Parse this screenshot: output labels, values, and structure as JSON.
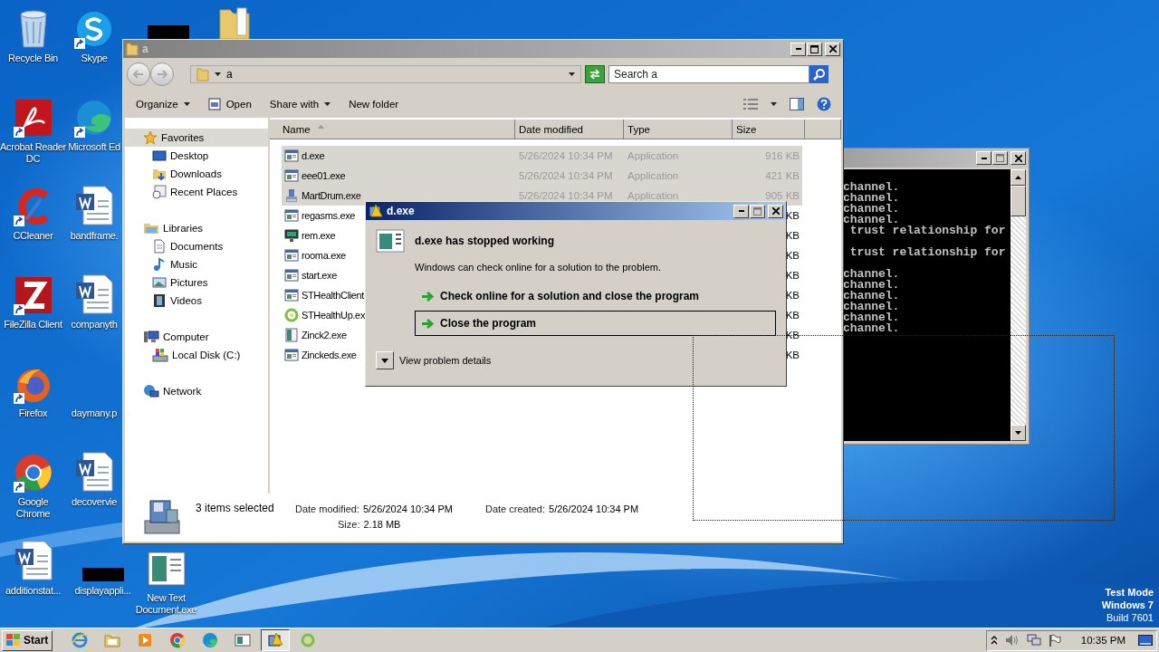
{
  "desktop": {
    "icons": [
      {
        "label": "Recycle Bin",
        "kind": "recycle",
        "shortcut": false
      },
      {
        "label": "Acrobat Reader DC",
        "kind": "acrobat",
        "shortcut": true
      },
      {
        "label": "CCleaner",
        "kind": "ccleaner",
        "shortcut": true
      },
      {
        "label": "FileZilla Client",
        "kind": "filezilla",
        "shortcut": true
      },
      {
        "label": "Firefox",
        "kind": "firefox",
        "shortcut": true
      },
      {
        "label": "Google Chrome",
        "kind": "chrome",
        "shortcut": true
      },
      {
        "label": "additionstat...",
        "kind": "word",
        "shortcut": false
      },
      {
        "label": "Skype",
        "kind": "skype",
        "shortcut": true
      },
      {
        "label": "Microsoft Ed",
        "kind": "edge",
        "shortcut": true
      },
      {
        "label": "bandframe.",
        "kind": "word",
        "shortcut": false
      },
      {
        "label": "companyth",
        "kind": "word",
        "shortcut": false
      },
      {
        "label": "daymany.p",
        "kind": "blank",
        "shortcut": false
      },
      {
        "label": "decovervie",
        "kind": "word",
        "shortcut": false
      },
      {
        "label": "displayappli...",
        "kind": "redacted",
        "shortcut": false
      },
      {
        "kind": "redacted",
        "shortcut": false
      },
      {
        "label": "New Text Document.exe",
        "kind": "appdoc",
        "shortcut": false
      },
      {
        "kind": "folder",
        "shortcut": false
      }
    ],
    "notice": [
      "Test Mode",
      "Windows 7",
      "Build 7601"
    ],
    "marquee": true
  },
  "console": {
    "lines": [
      {
        "text": "channel.",
        "blank_after": false
      },
      {
        "text": "channel.",
        "blank_after": false
      },
      {
        "text": "channel.",
        "blank_after": false
      },
      {
        "text": "channel.",
        "blank_after": false
      },
      {
        "text": " trust relationship for",
        "blank_after": true
      },
      {
        "text": " trust relationship for",
        "blank_after": true
      },
      {
        "text": "channel.",
        "blank_after": false
      },
      {
        "text": "channel.",
        "blank_after": false
      },
      {
        "text": "channel.",
        "blank_after": false
      },
      {
        "text": "channel.",
        "blank_after": false
      },
      {
        "text": "channel.",
        "blank_after": false
      },
      {
        "text": "channel.",
        "blank_after": false
      }
    ]
  },
  "explorer": {
    "title": "a",
    "address": "a",
    "search": {
      "placeholder": "Search a"
    },
    "toolbar": [
      {
        "label": "Organize",
        "kind": "menu"
      },
      {
        "label": "Open",
        "kind": "open"
      },
      {
        "label": "Share with",
        "kind": "menu"
      },
      {
        "label": "New folder",
        "kind": "plain"
      }
    ],
    "nav": [
      {
        "label": "Favorites",
        "kind": "star",
        "selected": true,
        "children": [
          {
            "label": "Desktop",
            "kind": "desktop",
            "selected": false
          },
          {
            "label": "Downloads",
            "kind": "downloads",
            "selected": false
          },
          {
            "label": "Recent Places",
            "kind": "recent",
            "selected": false
          }
        ]
      },
      {
        "label": "Libraries",
        "kind": "library",
        "selected": false,
        "children": [
          {
            "label": "Documents",
            "kind": "documents",
            "selected": false
          },
          {
            "label": "Music",
            "kind": "music",
            "selected": false
          },
          {
            "label": "Pictures",
            "kind": "pictures",
            "selected": false
          },
          {
            "label": "Videos",
            "kind": "videos",
            "selected": false
          }
        ]
      },
      {
        "label": "Computer",
        "kind": "computer",
        "selected": false,
        "children": [
          {
            "label": "Local Disk (C:)",
            "kind": "disk",
            "selected": false
          }
        ]
      },
      {
        "label": "Network",
        "kind": "network",
        "selected": false
      }
    ],
    "columns": [
      "Name",
      "Date modified",
      "Type",
      "Size"
    ],
    "files": [
      {
        "name": "d.exe",
        "kind": "app",
        "selected": true,
        "date": "5/26/2024 10:34 PM",
        "type": "Application",
        "size": "916 KB"
      },
      {
        "name": "eee01.exe",
        "kind": "app",
        "selected": true,
        "date": "5/26/2024 10:34 PM",
        "type": "Application",
        "size": "421 KB"
      },
      {
        "name": "MartDrum.exe",
        "kind": "installer",
        "selected": true,
        "date": "5/26/2024 10:34 PM",
        "type": "Application",
        "size": "905 KB"
      },
      {
        "name": "regasms.exe",
        "kind": "app",
        "selected": false,
        "size": "KB"
      },
      {
        "name": "rem.exe",
        "kind": "monitor",
        "selected": false,
        "size": "KB"
      },
      {
        "name": "rooma.exe",
        "kind": "app",
        "selected": false,
        "size": "KB"
      },
      {
        "name": "start.exe",
        "kind": "app",
        "selected": false,
        "size": "KB"
      },
      {
        "name": "STHealthClient",
        "kind": "app",
        "selected": false,
        "size": "KB"
      },
      {
        "name": "STHealthUp.ex",
        "kind": "ring",
        "selected": false,
        "size": "KB"
      },
      {
        "name": "Zinck2.exe",
        "kind": "zinck",
        "selected": false,
        "size": "KB"
      },
      {
        "name": "Zinckeds.exe",
        "kind": "app",
        "selected": false,
        "size": "KB"
      }
    ],
    "details": {
      "summary": "3 items selected",
      "fields": [
        {
          "label": "Date modified:",
          "value": "5/26/2024 10:34 PM"
        },
        {
          "label": "Date created:",
          "value": "5/26/2024 10:34 PM"
        },
        {
          "label": "Size:",
          "value": "2.18 MB"
        }
      ]
    }
  },
  "dialog": {
    "title": "d.exe",
    "heading": "d.exe has stopped working",
    "message": "Windows can check online for a solution to the problem.",
    "options": [
      {
        "label": "Check online for a solution and close the program",
        "focused": false
      },
      {
        "label": "Close the program",
        "focused": true
      }
    ],
    "details_toggle": "View problem details"
  },
  "taskbar": {
    "start": "Start",
    "items": [
      {
        "kind": "ie",
        "active": false
      },
      {
        "kind": "explorer",
        "active": false
      },
      {
        "kind": "media",
        "active": false
      },
      {
        "kind": "chrome",
        "active": false
      },
      {
        "kind": "edge",
        "active": false
      },
      {
        "kind": "window",
        "active": false
      },
      {
        "kind": "error",
        "active": true
      },
      {
        "kind": "ring",
        "active": false
      }
    ],
    "clock": "10:35 PM"
  }
}
